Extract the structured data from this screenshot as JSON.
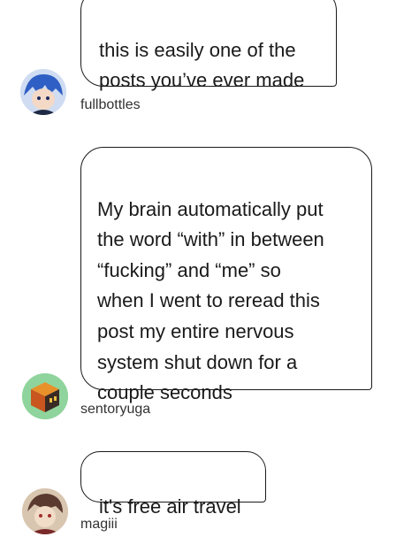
{
  "comments": [
    {
      "text": "this is easily one of the\nposts you’ve ever made",
      "user": "fullbottles",
      "avatar_icon": "anime-character-avatar-icon"
    },
    {
      "text": "My brain automatically put\nthe word “with” in between\n“fucking” and “me” so\nwhen I went to reread this\npost my entire nervous\nsystem shut down for a\ncouple seconds",
      "user": "sentoryuga",
      "avatar_icon": "cube-avatar-icon"
    },
    {
      "text": "it's free air travel",
      "user": "magiii",
      "avatar_icon": "character-avatar-icon"
    }
  ],
  "colors": {
    "bubble_border": "#1a1a1a",
    "username": "#333333"
  }
}
